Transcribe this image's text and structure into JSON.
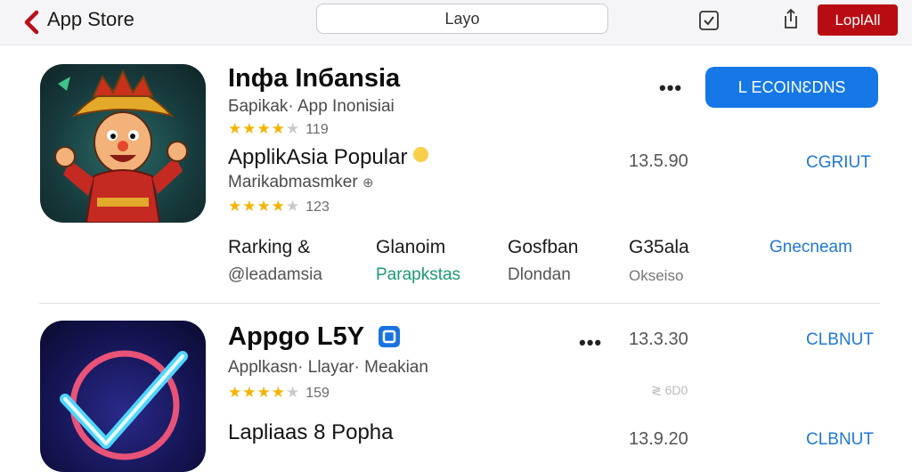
{
  "topbar": {
    "back_label": "App  Store",
    "search_value": "Layo",
    "action_button": "LoplAll"
  },
  "app1": {
    "title": "Inфa Inбansia",
    "subtitle": "Бapikak· App  Inonisiai",
    "rating_stars": 4.5,
    "rating_count": "119",
    "primary_button": "Ⅼ  ECOINƐDNS",
    "section_title": "ApplikAsia Popular",
    "section_subtitle": "Marikabmasmker",
    "section_rating_stars": 4,
    "section_rating_count": "123",
    "price": "13.5.90",
    "get_label": "CGRIUT",
    "stats": [
      {
        "heading": "Rarking &",
        "value": "@leadamsia"
      },
      {
        "heading": "Glanoim",
        "value": "Parapkstas"
      },
      {
        "heading": "Gosfban",
        "value": "Dlondan"
      },
      {
        "heading": "G35ala",
        "value": "Okseiso"
      }
    ],
    "stats_link": "Gnecneam"
  },
  "app2": {
    "title": "Appgo L5Y",
    "subtitle": "Applkasn· Llayar· Meakian",
    "rating_stars": 4,
    "rating_count": "159",
    "price": "13.3.30",
    "get_label": "CLBNUT",
    "price_note": "≷ 6D0",
    "section_title": "Lapliaas 8 Popha",
    "section_price": "13.9.20",
    "section_get_label": "CLBNUT"
  },
  "colors": {
    "accent_blue": "#1578e6",
    "link_blue": "#1f78d6",
    "brand_red": "#b90c12",
    "star_gold": "#f4b400"
  },
  "icons": [
    "chevron-left-icon",
    "checkbox-icon",
    "share-icon",
    "more-icon",
    "verified-badge-icon",
    "emoji-icon",
    "info-icon"
  ]
}
